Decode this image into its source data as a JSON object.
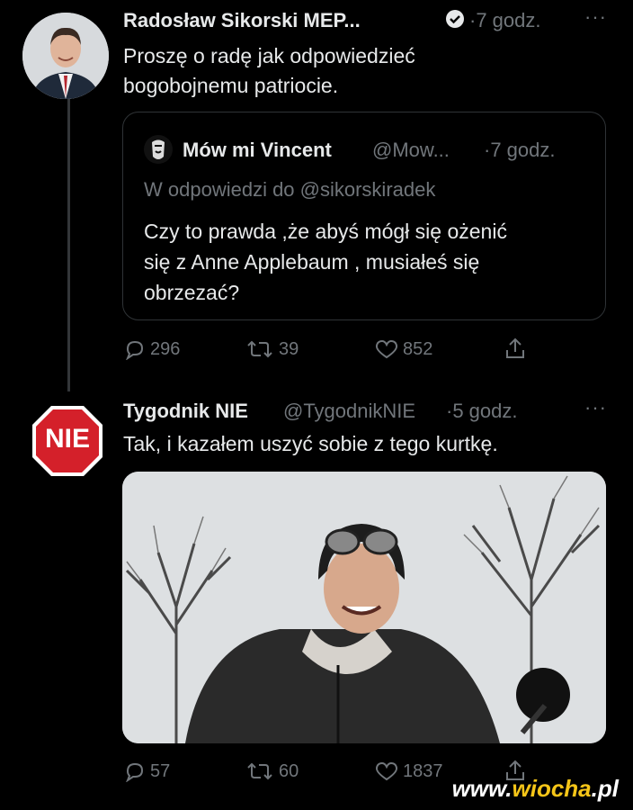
{
  "tweet1": {
    "author": "Radosław Sikorski MEP...",
    "time": "7 godz.",
    "text_line1": "Proszę o radę jak odpowiedzieć",
    "text_line2": "bogobojnemu patriocie.",
    "more": "···",
    "quote": {
      "author": "Mów mi Vincent",
      "handle": "@Mow...",
      "time": "7 godz.",
      "reply_to": "W odpowiedzi do @sikorskiradek",
      "text_line1": "Czy to prawda ,że abyś mógł się ożenić",
      "text_line2": "się z Anne Applebaum , musiałeś się",
      "text_line3": "obrzezać?"
    },
    "replies": "296",
    "retweets": "39",
    "likes": "852"
  },
  "tweet2": {
    "author": "Tygodnik NIE",
    "handle": "@TygodnikNIE",
    "time": "5 godz.",
    "text": "Tak, i kazałem uszyć sobie z tego kurtkę.",
    "avatar_text": "NIE",
    "more": "···",
    "replies": "57",
    "retweets": "60",
    "likes": "1837"
  },
  "watermark": {
    "prefix": "www.",
    "domain": "wiocha",
    "suffix": ".pl"
  }
}
